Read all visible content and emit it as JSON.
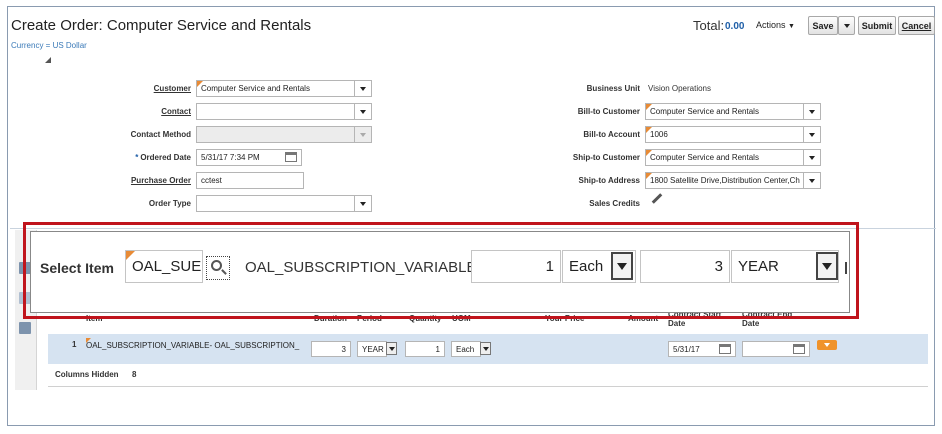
{
  "header": {
    "title": "Create Order: Computer Service and Rentals",
    "currency": "Currency = US Dollar",
    "total_label": "Total:",
    "total_value": "0.00",
    "actions_label": "Actions",
    "save_label": "Save",
    "submit_label": "Submit",
    "cancel_label": "Cancel"
  },
  "form_left": {
    "customer_label": "Customer",
    "customer_value": "Computer Service and Rentals",
    "contact_label": "Contact",
    "contact_value": "",
    "contact_method_label": "Contact Method",
    "contact_method_value": "",
    "ordered_date_label": "Ordered Date",
    "ordered_date_required": "*",
    "ordered_date_value": "5/31/17 7:34 PM",
    "purchase_order_label": "Purchase Order",
    "purchase_order_value": "cctest",
    "order_type_label": "Order Type",
    "order_type_value": ""
  },
  "form_right": {
    "business_unit_label": "Business Unit",
    "business_unit_value": "Vision Operations",
    "bill_to_customer_label": "Bill-to Customer",
    "bill_to_customer_value": "Computer Service and Rentals",
    "bill_to_account_label": "Bill-to Account",
    "bill_to_account_value": "1006",
    "ship_to_customer_label": "Ship-to Customer",
    "ship_to_customer_value": "Computer Service and Rentals",
    "ship_to_address_label": "Ship-to Address",
    "ship_to_address_value": "1800 Satellite Drive,Distribution Center,Ch",
    "sales_credits_label": "Sales Credits"
  },
  "zoom": {
    "select_item_label": "Select Item",
    "item_value": "OAL_SUE",
    "item_description": "OAL_SUBSCRIPTION_VARIABLE",
    "quantity": "1",
    "uom": "Each",
    "duration": "3",
    "period": "YEAR"
  },
  "table": {
    "headers": {
      "item": "Item",
      "duration": "Duration",
      "period": "Period",
      "quantity": "Quantity",
      "uom": "UOM",
      "your_price": "Your Price",
      "amount": "Amount",
      "contract_start": "Contract Start Date",
      "contract_end": "Contract End Date"
    },
    "row": {
      "num": "1",
      "item": "OAL_SUBSCRIPTION_VARIABLE- OAL_SUBSCRIPTION_",
      "duration": "3",
      "period": "YEAR",
      "quantity": "1",
      "uom": "Each",
      "contract_start": "5/31/17",
      "contract_end": ""
    },
    "columns_hidden_label": "Columns Hidden",
    "columns_hidden_value": "8"
  },
  "colors": {
    "highlight_box": "#c0141c",
    "required_flag": "#e88b36",
    "row_selected": "#d6e3f1",
    "link": "#1f5fa8"
  }
}
